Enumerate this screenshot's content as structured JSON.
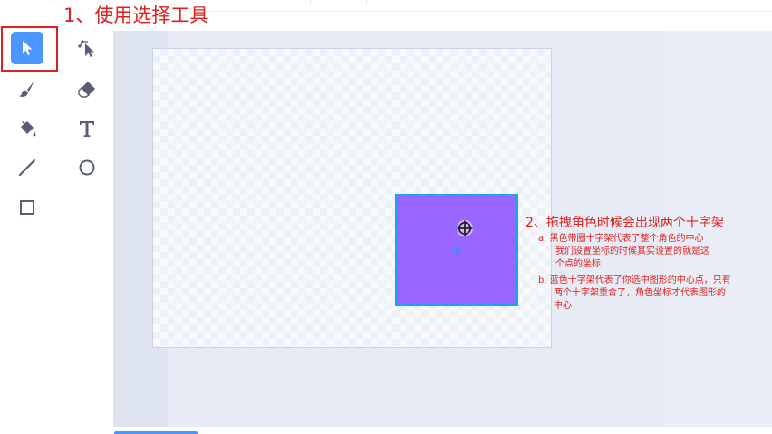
{
  "annotations": {
    "step1": "1、使用选择工具",
    "step2": "2、拖拽角色时候会出现两个十字架",
    "note_a_1": "a. 黑色带圈十字架代表了整个角色的中心",
    "note_a_2": "我们设置坐标的时候其实设置的就是这",
    "note_a_3": "个点的坐标",
    "note_b_1": "b. 蓝色十字架代表了你选中图形的中心点，只有",
    "note_b_2": "两个十字架重合了，角色坐标才代表图形的",
    "note_b_3": "中心"
  },
  "toolbar": {
    "tools": [
      {
        "name": "select",
        "icon": "arrow-pointer-icon",
        "active": true
      },
      {
        "name": "reshape",
        "icon": "reshape-pointer-icon",
        "active": false
      },
      {
        "name": "brush",
        "icon": "brush-icon",
        "active": false
      },
      {
        "name": "eraser",
        "icon": "eraser-icon",
        "active": false
      },
      {
        "name": "fill",
        "icon": "paint-bucket-icon",
        "active": false
      },
      {
        "name": "text",
        "icon": "text-t-icon",
        "active": false
      },
      {
        "name": "line",
        "icon": "line-icon",
        "active": false
      },
      {
        "name": "circle",
        "icon": "circle-icon",
        "active": false
      },
      {
        "name": "rectangle",
        "icon": "rectangle-icon",
        "active": false
      }
    ]
  },
  "colors": {
    "accent": "#4c97ff",
    "annotation": "#e0201e",
    "sprite_fill": "#9966ff",
    "sprite_border": "#1da1f2"
  }
}
